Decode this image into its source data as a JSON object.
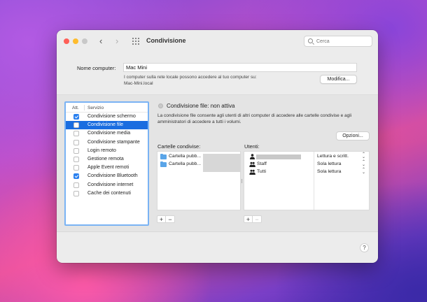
{
  "window": {
    "title": "Condivisione",
    "search_placeholder": "Cerca"
  },
  "computer": {
    "label": "Nome computer:",
    "name": "Mac Mini",
    "description_line1": "I computer sulla rete locale possono accedere al tuo computer su:",
    "description_line2": "Mac-Mini.local",
    "modify_button": "Modifica..."
  },
  "services": {
    "header_on": "Att.",
    "header_service": "Servizio",
    "items": [
      {
        "label": "Condivisione schermo",
        "checked": true,
        "selected": false
      },
      {
        "label": "Condivisione file",
        "checked": false,
        "selected": true
      },
      {
        "label": "Condivisione media",
        "checked": false,
        "selected": false
      },
      {
        "label": "Condivisione stampante",
        "checked": false,
        "selected": false
      },
      {
        "label": "Login remoto",
        "checked": false,
        "selected": false
      },
      {
        "label": "Gestione remota",
        "checked": false,
        "selected": false
      },
      {
        "label": "Apple Event remoti",
        "checked": false,
        "selected": false
      },
      {
        "label": "Condivisione Bluetooth",
        "checked": true,
        "selected": false
      },
      {
        "label": "Condivisione internet",
        "checked": false,
        "selected": false
      },
      {
        "label": "Cache dei contenuti",
        "checked": false,
        "selected": false
      }
    ]
  },
  "detail": {
    "status": "Condivisione file: non attiva",
    "description": "La condivisione file consente agli utenti di altri computer di accedere alle cartelle condivise e agli amministratori di accedere a tutti i volumi.",
    "options_button": "Opzioni...",
    "shared_folders_label": "Cartelle condivise:",
    "users_label": "Utenti:",
    "shared_folders": [
      {
        "label": "Cartella pubb..."
      },
      {
        "label": "Cartella pubb..."
      }
    ],
    "users": [
      {
        "name": "",
        "permission": "Lettura e scritt.",
        "icon": "single-user-icon"
      },
      {
        "name": "Staff",
        "permission": "Sola lettura",
        "icon": "group-icon"
      },
      {
        "name": "Tutti",
        "permission": "Sola lettura",
        "icon": "group-icon"
      }
    ],
    "add_symbol": "+",
    "remove_symbol": "−"
  },
  "help_symbol": "?",
  "colors": {
    "selection": "#1a6de0",
    "checkbox_on": "#2a80ef",
    "panel_focus": "#7ab3f4"
  }
}
